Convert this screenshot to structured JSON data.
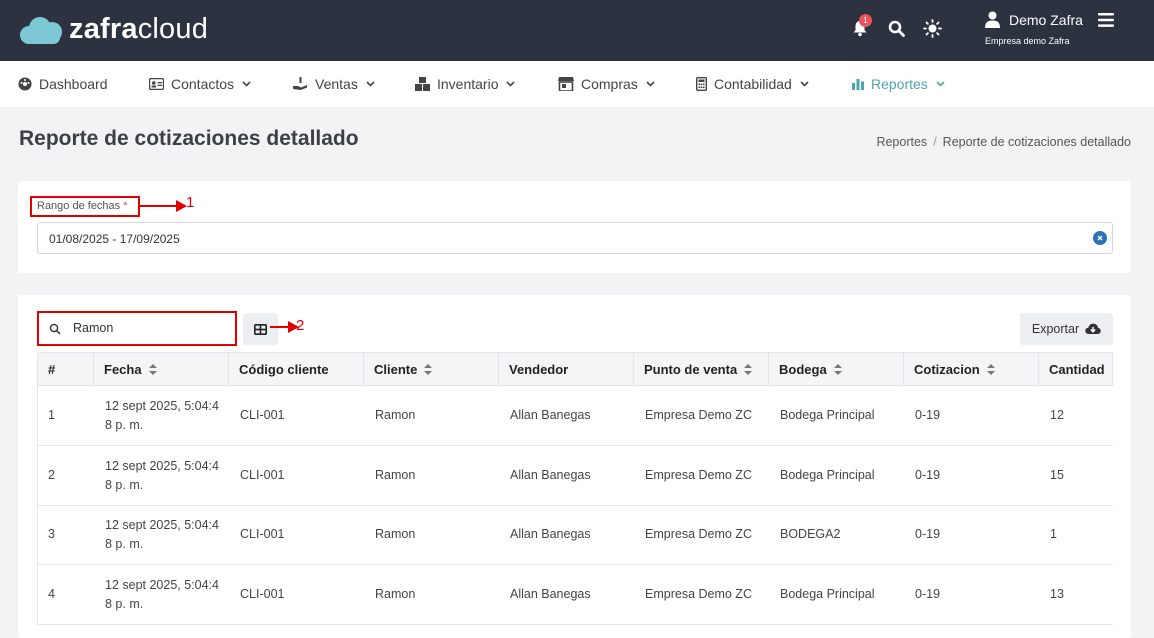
{
  "header": {
    "logo_bold": "zafra",
    "logo_light": "cloud",
    "notification_count": "1",
    "user_name": "Demo Zafra",
    "company": "Empresa demo Zafra"
  },
  "nav": [
    {
      "label": "Dashboard",
      "icon": "dashboard-icon"
    },
    {
      "label": "Contactos",
      "icon": "contacts-icon"
    },
    {
      "label": "Ventas",
      "icon": "sales-icon"
    },
    {
      "label": "Inventario",
      "icon": "inventory-icon"
    },
    {
      "label": "Compras",
      "icon": "store-icon"
    },
    {
      "label": "Contabilidad",
      "icon": "calculator-icon"
    },
    {
      "label": "Reportes",
      "icon": "chart-icon",
      "active": true
    }
  ],
  "page": {
    "title": "Reporte de cotizaciones detallado",
    "breadcrumb": [
      "Reportes",
      "Reporte de cotizaciones detallado"
    ]
  },
  "filters": {
    "date_label": "Rango de fechas",
    "required_mark": "*",
    "date_value": "01/08/2025  - 17/09/2025"
  },
  "annotations": [
    "1",
    "2"
  ],
  "toolbar": {
    "search_value": "Ramon",
    "export_label": "Exportar"
  },
  "table": {
    "columns": [
      "#",
      "Fecha",
      "Código cliente",
      "Cliente",
      "Vendedor",
      "Punto de venta",
      "Bodega",
      "Cotizacion",
      "Cantidad"
    ],
    "rows": [
      {
        "num": "1",
        "fecha1": "12 sept 2025, 5:04:4",
        "fecha2": "8 p. m.",
        "codigo": "CLI-001",
        "cliente": "Ramon",
        "vendedor": "Allan Banegas",
        "punto": "Empresa Demo ZC",
        "bodega": "Bodega Principal",
        "cotizacion": "0-19",
        "cantidad": "12"
      },
      {
        "num": "2",
        "fecha1": "12 sept 2025, 5:04:4",
        "fecha2": "8 p. m.",
        "codigo": "CLI-001",
        "cliente": "Ramon",
        "vendedor": "Allan Banegas",
        "punto": "Empresa Demo ZC",
        "bodega": "Bodega Principal",
        "cotizacion": "0-19",
        "cantidad": "15"
      },
      {
        "num": "3",
        "fecha1": "12 sept 2025, 5:04:4",
        "fecha2": "8 p. m.",
        "codigo": "CLI-001",
        "cliente": "Ramon",
        "vendedor": "Allan Banegas",
        "punto": "Empresa Demo ZC",
        "bodega": "BODEGA2",
        "cotizacion": "0-19",
        "cantidad": "1"
      },
      {
        "num": "4",
        "fecha1": "12 sept 2025, 5:04:4",
        "fecha2": "8 p. m.",
        "codigo": "CLI-001",
        "cliente": "Ramon",
        "vendedor": "Allan Banegas",
        "punto": "Empresa Demo ZC",
        "bodega": "Bodega Principal",
        "cotizacion": "0-19",
        "cantidad": "13"
      }
    ]
  },
  "colors": {
    "topbar": "#2c3240",
    "accent": "#4aa6b1",
    "annotation": "#e00000"
  }
}
